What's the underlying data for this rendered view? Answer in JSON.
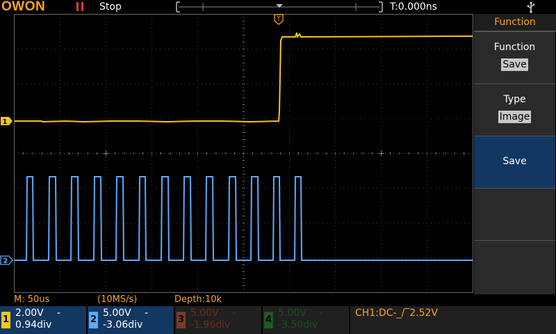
{
  "header": {
    "logo": "OWON",
    "status": "Stop",
    "trigger_time": "T:0.000ns"
  },
  "menu": {
    "title": "Function",
    "items": [
      {
        "label": "Function",
        "value": "Save"
      },
      {
        "label": "Type",
        "value": "Image"
      },
      {
        "label": "Save",
        "value": ""
      },
      {
        "label": "",
        "value": ""
      },
      {
        "label": "",
        "value": ""
      }
    ]
  },
  "infoline": {
    "timebase": "M: 50us",
    "sample_rate": "(10MS/s)",
    "depth": "Depth:10k"
  },
  "channels": [
    {
      "num": "1",
      "volts": "2.00V",
      "coupling": "-",
      "offset": "0.94div",
      "color": "#f5c518",
      "text": "#ffffff",
      "bg": "#123761"
    },
    {
      "num": "2",
      "volts": "5.00V",
      "coupling": "-",
      "offset": "-3.06div",
      "color": "#5aaaff",
      "text": "#ffffff",
      "bg": "#123761"
    },
    {
      "num": "3",
      "volts": "5.00V",
      "coupling": "-",
      "offset": "-1.96div",
      "color": "#7a3a22",
      "text": "#6a2f1c",
      "bg": "#202020"
    },
    {
      "num": "4",
      "volts": "5.00V",
      "coupling": "-",
      "offset": "-3.50div",
      "color": "#1f5a1f",
      "text": "#1e4e1e",
      "bg": "#202020"
    }
  ],
  "trigger_info": "CH1:DC-_/‾2.52V",
  "markers": {
    "ch1": "1",
    "ch2": "2",
    "trigger": "T"
  },
  "colors": {
    "ch1": "#f5c518",
    "ch2": "#5aaaff",
    "accent": "#f5a623",
    "menu_active": "#123761"
  }
}
